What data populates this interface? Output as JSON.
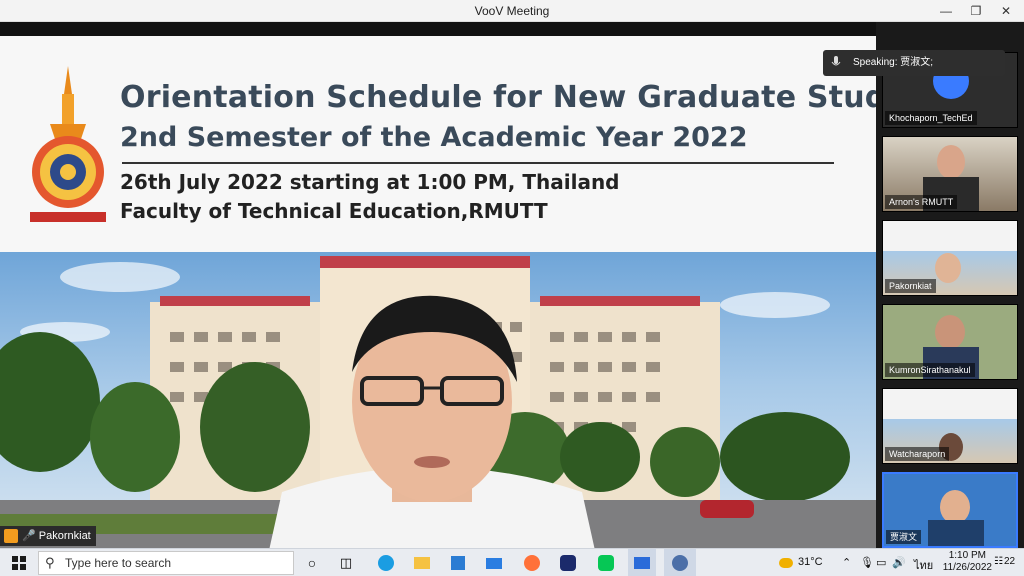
{
  "window": {
    "title": "VooV Meeting"
  },
  "banner": {
    "title_line1": "Orientation Schedule for New Graduate Students",
    "title_line2": "2nd Semester of the Academic Year 2022",
    "date_line": "26th July 2022 starting at 1:00 PM, Thailand",
    "faculty_line": "Faculty of Technical Education,RMUTT"
  },
  "main": {
    "speaker_name": "Pakornkiat"
  },
  "speaking": {
    "label": "Speaking: 贾淑文;"
  },
  "participants": [
    {
      "name": "Khochaporn_TechEd"
    },
    {
      "name": "Arnon's RMUTT"
    },
    {
      "name": "Pakornkiat"
    },
    {
      "name": "KumronSirathanakul"
    },
    {
      "name": "Watcharaporn"
    },
    {
      "name": "贾淑文"
    }
  ],
  "taskbar": {
    "search_placeholder": "Type here to search",
    "weather": "31°C",
    "language": "ไทย",
    "time": "1:10 PM",
    "date": "11/26/2022",
    "notifications": "22"
  },
  "colors": {
    "accent": "#3a7bff",
    "banner_text": "#3a4a5a",
    "taskbar": "#e9ecf1"
  }
}
